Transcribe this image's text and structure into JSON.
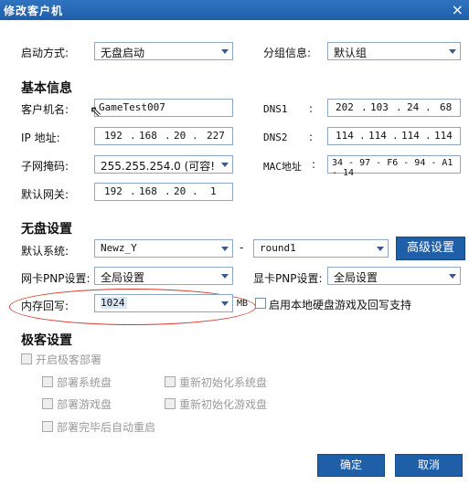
{
  "window": {
    "title": "修改客户机",
    "close": "×"
  },
  "boot_mode": {
    "label": "启动方式:",
    "value": "无盘启动"
  },
  "group": {
    "label": "分组信息:",
    "value": "默认组"
  },
  "basic": {
    "heading": "基本信息",
    "hostname_label": "客户机名:",
    "hostname": "GameTest007",
    "ip_label": "IP  地址:",
    "ip": [
      "192",
      "168",
      "20",
      "227"
    ],
    "mask_label": "子网掩码:",
    "mask_value": "255.255.254.0",
    "mask_hint": "(可容!",
    "gw_label": "默认网关:",
    "gw": [
      "192",
      "168",
      "20",
      "1"
    ],
    "dns1_label": "DNS1",
    "dns1": [
      "202",
      "103",
      "24",
      "68"
    ],
    "dns2_label": "DNS2",
    "dns2": [
      "114",
      "114",
      "114",
      "114"
    ],
    "mac_label": "MAC地址",
    "mac": "34 - 97 - F6 - 94 - A1 - 14",
    "colon": ":"
  },
  "diskless": {
    "heading": "无盘设置",
    "system_label": "默认系统:",
    "system_value": "Newz_Y",
    "dash": "-",
    "round_value": "round1",
    "advanced_button": "高级设置",
    "nic_label": "网卡PNP设置:",
    "nic_value": "全局设置",
    "gpu_label": "显卡PNP设置:",
    "gpu_value": "全局设置",
    "cache_label": "内存回写:",
    "cache_value": "1024",
    "cache_unit": "MB",
    "local_disk_label": "启用本地硬盘游戏及回写支持"
  },
  "express": {
    "heading": "极客设置",
    "enable_label": "开启极客部署",
    "deploy_system": "部署系统盘",
    "reinit_system": "重新初始化系统盘",
    "deploy_game": "部署游戏盘",
    "reinit_game": "重新初始化游戏盘",
    "reboot_after": "部署完毕后自动重启"
  },
  "footer": {
    "ok": "确定",
    "cancel": "取消"
  },
  "colors": {
    "titlebar": "#1f5fa8",
    "button": "#1f5fa8",
    "annotation": "#d23a2a"
  }
}
